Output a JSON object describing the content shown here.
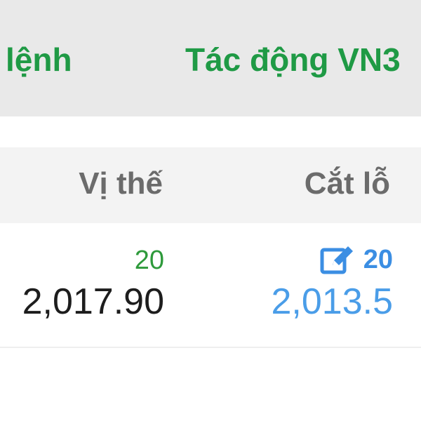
{
  "tabs": {
    "left_label": "lệnh",
    "right_label": "Tác động VN3"
  },
  "table": {
    "headers": {
      "position": "Vị thế",
      "stop_loss": "Cắt lỗ"
    },
    "row": {
      "position_qty": "20",
      "position_price": "2,017.90",
      "stop_loss_qty": "20",
      "stop_loss_price": "2,013.5"
    }
  },
  "icons": {
    "edit": "edit-icon"
  },
  "colors": {
    "tab_green": "#1f9a45",
    "qty_green": "#2e9a3b",
    "stop_blue": "#3b8ee3",
    "header_gray": "#6b6b6b"
  }
}
